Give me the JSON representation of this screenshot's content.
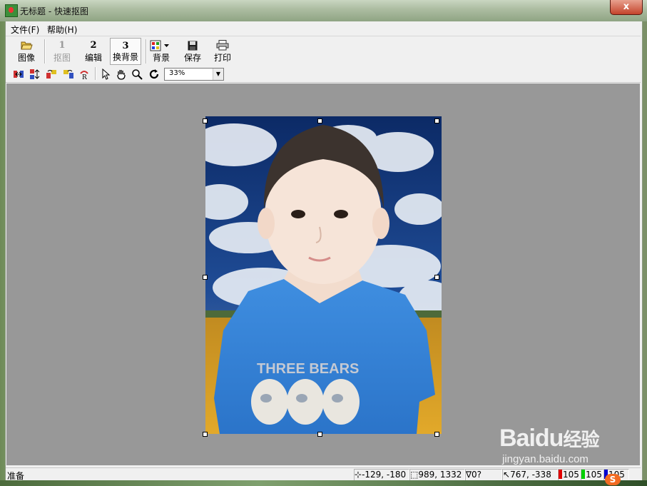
{
  "window": {
    "title": "无标题 - 快速抠图",
    "close_label": "x"
  },
  "menu": [
    {
      "label": "文件(F)"
    },
    {
      "label": "帮助(H)"
    }
  ],
  "toolbar": {
    "image_label": "图像",
    "step1_num": "1",
    "step1_label": "抠图",
    "step2_num": "2",
    "step2_label": "编辑",
    "step3_num": "3",
    "step3_label": "换背景",
    "background_label": "背景",
    "save_label": "保存",
    "print_label": "打印"
  },
  "toolbar2": {
    "zoom_value": "33%"
  },
  "status": {
    "ready": "准备",
    "position": "-129, -180",
    "size": "989, 1332",
    "angle": "0?",
    "cursor": "767, -338",
    "r": "105",
    "g": "105",
    "b": "105",
    "colors": {
      "r": "#e00000",
      "g": "#00d000",
      "b": "#0000d0"
    }
  },
  "photo": {
    "shirt_text": "THREE BEARS"
  },
  "watermark": {
    "brand": "Baidu",
    "brand_suffix": "经验",
    "url": "jingyan.baidu.com"
  }
}
